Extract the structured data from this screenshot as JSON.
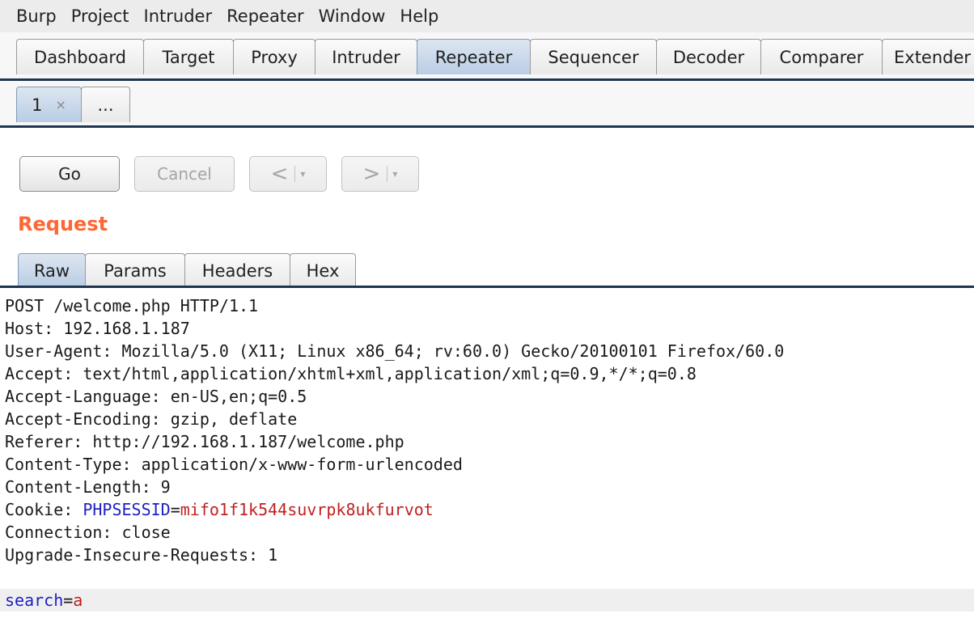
{
  "menu": [
    "Burp",
    "Project",
    "Intruder",
    "Repeater",
    "Window",
    "Help"
  ],
  "main_tabs": [
    "Dashboard",
    "Target",
    "Proxy",
    "Intruder",
    "Repeater",
    "Sequencer",
    "Decoder",
    "Comparer",
    "Extender"
  ],
  "active_main_tab": "Repeater",
  "sub_tabs": [
    {
      "label": "1",
      "close": "×"
    },
    {
      "label": "..."
    }
  ],
  "buttons": {
    "go": "Go",
    "cancel": "Cancel",
    "back": "<",
    "forward": ">",
    "dropdown": "▾"
  },
  "request_title": "Request",
  "request_tabs": [
    "Raw",
    "Params",
    "Headers",
    "Hex"
  ],
  "raw_lines": [
    "POST /welcome.php HTTP/1.1",
    "Host: 192.168.1.187",
    "User-Agent: Mozilla/5.0 (X11; Linux x86_64; rv:60.0) Gecko/20100101 Firefox/60.0",
    "Accept: text/html,application/xhtml+xml,application/xml;q=0.9,*/*;q=0.8",
    "Accept-Language: en-US,en;q=0.5",
    "Accept-Encoding: gzip, deflate",
    "Referer: http://192.168.1.187/welcome.php",
    "Content-Type: application/x-www-form-urlencoded",
    "Content-Length: 9"
  ],
  "cookie_line": {
    "prefix": "Cookie: ",
    "name": "PHPSESSID",
    "eq": "=",
    "value": "mifo1f1k544suvrpk8ukfurvot"
  },
  "raw_lines_after": [
    "Connection: close",
    "Upgrade-Insecure-Requests: 1"
  ],
  "body_line": {
    "name": "search",
    "eq": "=",
    "value": "a"
  },
  "colors": {
    "accent": "#ff6633",
    "param_name": "#1f1fc4",
    "param_value": "#c22020",
    "tab_line": "#1e3552"
  }
}
